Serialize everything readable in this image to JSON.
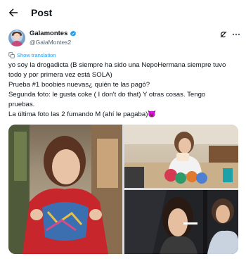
{
  "header": {
    "title": "Post"
  },
  "author": {
    "display_name": "Galamontes",
    "handle": "@GalaMontes2"
  },
  "translate": {
    "label": "Show translation"
  },
  "tweet": {
    "lines": [
      "yo soy la drogadicta (B siempre ha sido una NepoHermana siempre tuvo",
      "todo y por primera vez está SOLA)",
      "Prueba #1  boobies nuevas¿ quién te las pagó?",
      " Segunda foto: le gusta  coke ( I don't do that) Y otras cosas.  Tengo",
      "pruebas.",
      "La última foto las 2 fumando M (ahí le pagaba)😈"
    ]
  },
  "colors": {
    "accent": "#1d9bf0",
    "text": "#0f1419",
    "secondary": "#536471"
  },
  "icons": {
    "back": "arrow-left-icon",
    "verified": "verified-badge-icon",
    "grok": "grok-icon",
    "more": "more-icon",
    "translate": "translate-icon"
  }
}
